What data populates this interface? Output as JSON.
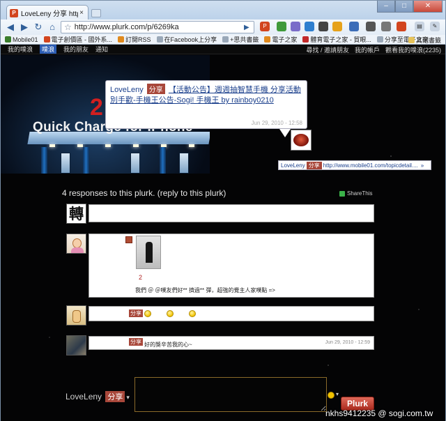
{
  "browser": {
    "tab_title": "LoveLeny 分享 http://w...",
    "tab_close": "×",
    "url": "http://www.plurk.com/p/6269ka",
    "win_controls": [
      "–",
      "□",
      "✕"
    ]
  },
  "bookmarks": [
    {
      "label": "Mobile01",
      "color": "#3a7d2c"
    },
    {
      "label": "電子創價區 - 國外系...",
      "color": "#d2451e"
    },
    {
      "label": "訂閱RSS",
      "color": "#e08a1e"
    },
    {
      "label": "在Facebook上分享",
      "color": "#9aa8b8"
    },
    {
      "label": "+思共書籤",
      "color": "#9aa8b8"
    },
    {
      "label": "電子之家",
      "color": "#e08a1e"
    },
    {
      "label": "體育電子之家 - 貿眼...",
      "color": "#c22a2a"
    },
    {
      "label": "分享至電子之家",
      "color": "#9aa8b8"
    }
  ],
  "bookmarks_other": "其他書籤",
  "site_nav": {
    "items": [
      "我的噗浪",
      "噗浪",
      "我的朋友",
      "通知"
    ],
    "active_index": 1,
    "right": [
      "尋找 / 邀請朋友",
      "我的帳戶",
      "觀看我的噗浪(2235)"
    ]
  },
  "banner": {
    "number": "2",
    "headline": "Quick Charge for iPhone"
  },
  "plurk": {
    "author": "LoveLeny",
    "qualifier": "分享",
    "content": "【活動公告】週週抽智慧手機 分享活動別手歡-手機王公告-Sogi! 手機王 by rainboy0210",
    "time": "Jun 29, 2010 - 12:58"
  },
  "mini_plurk": {
    "author": "LoveLeny",
    "qualifier": "分享",
    "text": "http://www.mobile01.com/topicdetail....",
    "arrow": "»"
  },
  "responses_header": "4 responses to this plurk. (reply to this plurk)",
  "share_label": "ShareThis",
  "responses": [
    {
      "avatar_text": "轉",
      "text": ""
    },
    {
      "photo_number": "2",
      "text": "我們 ＠ ＠噗友們好** 擠過** 彈，超強的覺主人家噗點 =>"
    },
    {
      "qualifier": "分享",
      "emoticons": 3
    },
    {
      "qualifier": "分享",
      "text": "好的獎辛苦我的心~",
      "time": "Jun 29, 2010 - 12:59"
    }
  ],
  "compose": {
    "name": "LoveLeny",
    "qualifier": "分享",
    "button": "Plurk"
  },
  "watermark": "nkhs9412235    @ sogi.com.tw"
}
